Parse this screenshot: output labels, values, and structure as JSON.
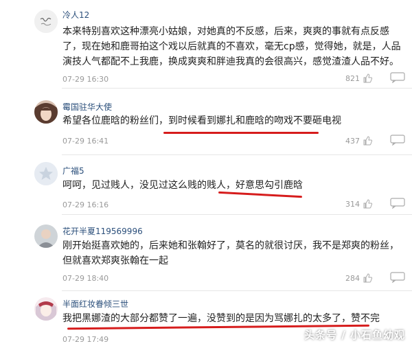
{
  "comments": [
    {
      "username": "冷人12",
      "text": "本来特别喜欢这种漂亮小姑娘，对她真的不反感，后来，爽爽的事就有点反感了，现在她和鹿哥拍这个戏以后就真的不喜欢，毫无cp感，觉得她，就是，人品演技人气都配不上我鹿，换成爽爽和胖迪我真的会很高兴，感觉渣渣人品不好。",
      "time": "07-29 16:30",
      "likes": "821",
      "avatar_icon": "calligraphy-avatar"
    },
    {
      "username": "霉国驻华大使",
      "text": "希望各位鹿晗的粉丝们，到时候看到娜扎和鹿晗的吻戏不要砸电视",
      "time": "07-29 16:41",
      "likes": "437",
      "avatar_icon": "girl-photo-avatar"
    },
    {
      "username": "广福5",
      "text": "呵呵，见过贱人，没见过这么贱的贱人，好意思勾引鹿晗",
      "time": "07-29 16:16",
      "likes": "314",
      "avatar_icon": "default-star-avatar"
    },
    {
      "username": "花开半夏119569996",
      "text": "刚开始挺喜欢她的，后来她和张翰好了，莫名的就很讨厌，我不是郑爽的粉丝，但就喜欢郑爽张翰在一起",
      "time": "07-29 18:40",
      "likes": "284",
      "avatar_icon": "person-photo-avatar"
    },
    {
      "username": "半面红妆眷倾三世",
      "text": "我把黑娜渣的大部分都赞了一遍，没赞到的是因为骂娜扎的太多了，赞不完",
      "time": "07-29 17:49",
      "likes": "",
      "avatar_icon": "anime-avatar"
    }
  ],
  "icons": {
    "like": "thumbs-up-icon",
    "reply": "comment-bubble-icon"
  },
  "colors": {
    "username": "#2b4f7b",
    "underline": "#d61c1c",
    "meta": "#999999"
  },
  "watermark": "头条号 / 小石鱼幼观"
}
